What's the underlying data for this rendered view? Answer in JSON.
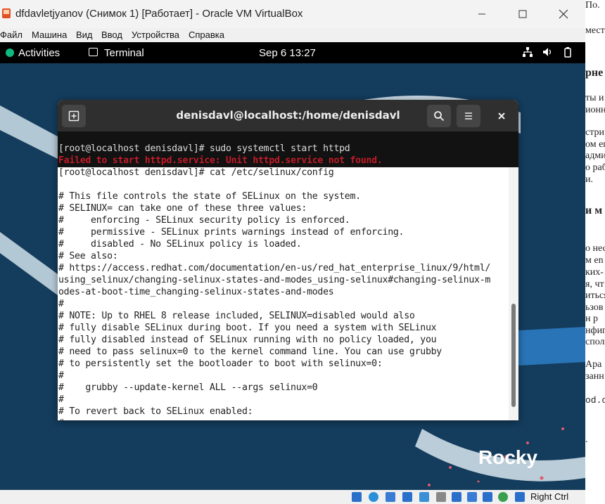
{
  "window": {
    "title": "dfdavletjyanov (Снимок 1) [Работает] - Oracle VM VirtualBox",
    "minimize": "—",
    "maximize": "☐",
    "close": "✕"
  },
  "menu": [
    "Файл",
    "Машина",
    "Вид",
    "Ввод",
    "Устройства",
    "Справка"
  ],
  "topbar": {
    "activities": "Activities",
    "app": "Terminal",
    "clock": "Sep 6  13:27"
  },
  "terminal": {
    "title": "denisdavl@localhost:/home/denisdavl",
    "lines": [
      "[root@localhost denisdavl]# sudo systemctl start httpd",
      "Failed to start httpd.service: Unit httpd.service not found.",
      "[root@localhost denisdavl]# cat /etc/selinux/config",
      "",
      "# This file controls the state of SELinux on the system.",
      "# SELINUX= can take one of these three values:",
      "#     enforcing - SELinux security policy is enforced.",
      "#     permissive - SELinux prints warnings instead of enforcing.",
      "#     disabled - No SELinux policy is loaded.",
      "# See also:",
      "# https://access.redhat.com/documentation/en-us/red_hat_enterprise_linux/9/html/",
      "using_selinux/changing-selinux-states-and-modes_using-selinux#changing-selinux-m",
      "odes-at-boot-time_changing-selinux-states-and-modes",
      "#",
      "# NOTE: Up to RHEL 8 release included, SELINUX=disabled would also",
      "# fully disable SELinux during boot. If you need a system with SELinux",
      "# fully disabled instead of SELinux running with no policy loaded, you",
      "# need to pass selinux=0 to the kernel command line. You can use grubby",
      "# to persistently set the bootloader to boot with selinux=0:",
      "#",
      "#    grubby --update-kernel ALL --args selinux=0",
      "#",
      "# To revert back to SELinux enabled:",
      "#"
    ]
  },
  "wallpaper": {
    "logo": "Rocky"
  },
  "statusbar": {
    "host_key": "Right Ctrl"
  },
  "background_doc": {
    "fragments": [
      "По.",
      "мест",
      "рне",
      "ты и",
      "ионн",
      "стри",
      "ом ег",
      "адми",
      "о раб",
      "и.",
      "и м",
      "о нес",
      "м en",
      "ких-",
      "я, чт",
      "иться",
      "ьзов",
      "н р",
      "нфиг",
      "спол",
      "Ара",
      "занн",
      "od.c",
      "."
    ]
  },
  "colors": {
    "accent_green": "#10b981",
    "error_red": "#c01c28",
    "wallpaper_blue": "#143c5c"
  }
}
